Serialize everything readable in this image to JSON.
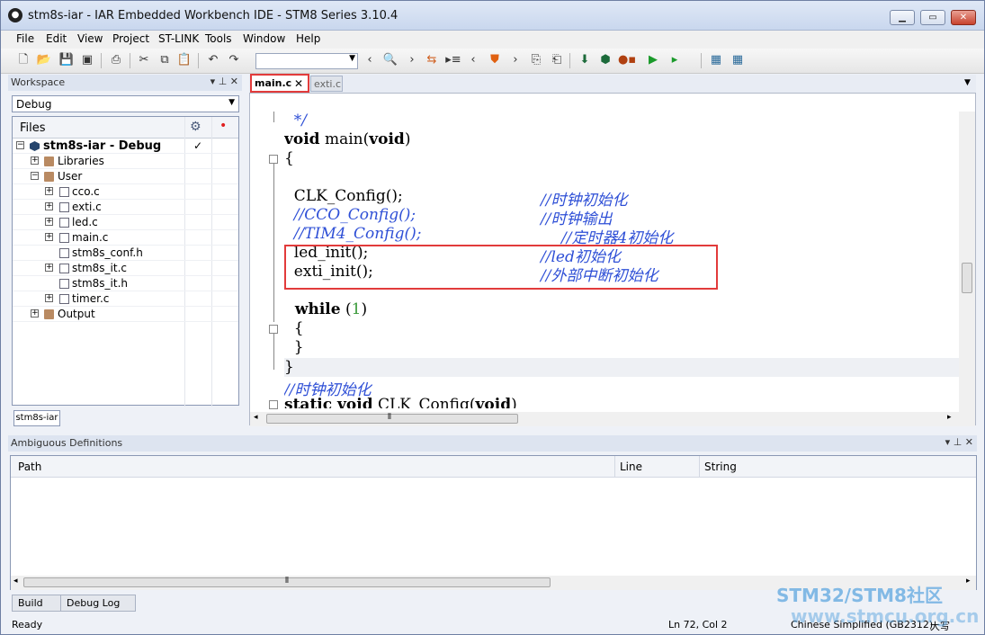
{
  "window": {
    "title": "stm8s-iar - IAR Embedded Workbench IDE - STM8 Series 3.10.4",
    "min": "▁",
    "max": "▭",
    "close": "✕"
  },
  "menu": [
    "File",
    "Edit",
    "View",
    "Project",
    "ST-LINK",
    "Tools",
    "Window",
    "Help"
  ],
  "workspace": {
    "title": "Workspace",
    "header_icons": "▾ ⊥ ✕",
    "config": "Debug",
    "files_title": "Files",
    "tab": "stm8s-iar",
    "tree": [
      {
        "label": "stm8s-iar - Debug",
        "check": "✓"
      },
      {
        "label": "Libraries"
      },
      {
        "label": "User"
      },
      {
        "label": "cco.c"
      },
      {
        "label": "exti.c"
      },
      {
        "label": "led.c"
      },
      {
        "label": "main.c"
      },
      {
        "label": "stm8s_conf.h"
      },
      {
        "label": "stm8s_it.c"
      },
      {
        "label": "stm8s_it.h"
      },
      {
        "label": "timer.c"
      },
      {
        "label": "Output"
      }
    ]
  },
  "editor": {
    "tabs": [
      {
        "label": "main.c",
        "close": "✕"
      },
      {
        "label": "exti.c"
      }
    ],
    "fn_icon": "f()",
    "code": {
      "l1": "  */",
      "l2a": "void",
      "l2b": " main(",
      "l2c": "void",
      "l2d": ")",
      "l3": "{",
      "l4a": "  CLK_Config();",
      "l4b": "//时钟初始化",
      "l5a": "  //CCO_Config();",
      "l5b": "//时钟输出",
      "l6a": "  //TIM4_Config();",
      "l6b": "//定时器4初始化",
      "l7a": "  led_init();",
      "l7b": "//led初始化",
      "l8a": "  exti_init();",
      "l8b": "//外部中断初始化",
      "l9a": "  while",
      "l9b": " (",
      "l9c": "1",
      "l9d": ")",
      "l10": "  {",
      "l11": "  }",
      "l12": "}",
      "l13": "//时钟初始化",
      "l14a": "static void",
      "l14b": " CLK_Config(",
      "l14c": "void",
      "l14d": ")"
    },
    "hscroll_grip": "⦀"
  },
  "ambiguous": {
    "title": "Ambiguous Definitions",
    "header_icons": "▾ ⊥ ✕",
    "columns": [
      "Path",
      "Line",
      "String"
    ]
  },
  "bottom_tabs": [
    "Build",
    "Debug Log"
  ],
  "status": {
    "ready": "Ready",
    "position": "Ln 72, Col 2",
    "encoding": "Chinese Simplified (GB2312)",
    "mode": "大写"
  },
  "watermark": {
    "line1": "STM32/STM8社区",
    "line2": "www.stmcu.org.cn"
  }
}
